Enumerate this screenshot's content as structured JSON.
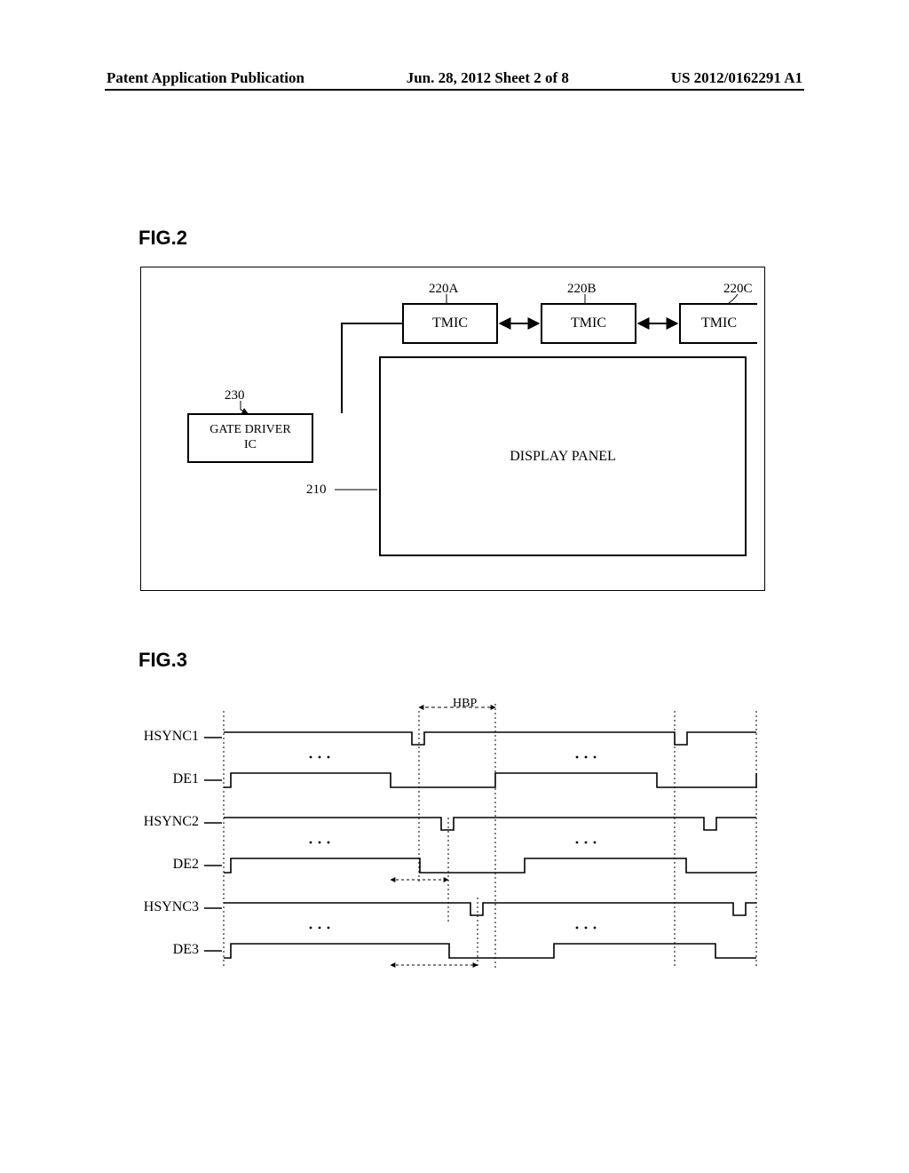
{
  "header": {
    "left": "Patent Application Publication",
    "mid": "Jun. 28, 2012  Sheet 2 of 8",
    "right": "US 2012/0162291 A1"
  },
  "figlabels": {
    "f2": "FIG.2",
    "f3": "FIG.3"
  },
  "fig2": {
    "tmic": "TMIC",
    "dispanel": "DISPLAY PANEL",
    "gatedrv": "GATE DRIVER\nIC",
    "ref220A": "220A",
    "ref220B": "220B",
    "ref220C": "220C",
    "ref230": "230",
    "ref210": "210"
  },
  "fig3": {
    "hbp": "HBP",
    "signals": [
      "HSYNC1",
      "DE1",
      "HSYNC2",
      "DE2",
      "HSYNC3",
      "DE3"
    ]
  },
  "chart_data": {
    "type": "table",
    "description": "Timing diagram: three sets of HSYNC (negative pulse) and DE (active-high) signals; HSYNC2/DE2 and HSYNC3/DE3 are progressively shifted right relative to HSYNC1/DE1. HBP (horizontal back porch) spans from HSYNC falling edge to DE rising edge.",
    "signals": [
      {
        "name": "HSYNC1",
        "type": "negative-pulse",
        "period_rel": 1.0,
        "offset_rel": 0.0,
        "pulse_width_rel": 0.03
      },
      {
        "name": "DE1",
        "type": "active-high-with-blank",
        "period_rel": 1.0,
        "offset_rel": 0.0,
        "blank_start_rel": 0.41,
        "blank_end_rel": 0.57
      },
      {
        "name": "HSYNC2",
        "type": "negative-pulse",
        "period_rel": 1.0,
        "offset_rel": 0.09,
        "pulse_width_rel": 0.03
      },
      {
        "name": "DE2",
        "type": "active-high-with-blank",
        "period_rel": 1.0,
        "offset_rel": 0.09,
        "blank_start_rel": 0.41,
        "blank_end_rel": 0.57
      },
      {
        "name": "HSYNC3",
        "type": "negative-pulse",
        "period_rel": 1.0,
        "offset_rel": 0.18,
        "pulse_width_rel": 0.03
      },
      {
        "name": "DE3",
        "type": "active-high-with-blank",
        "period_rel": 1.0,
        "offset_rel": 0.18,
        "blank_start_rel": 0.41,
        "blank_end_rel": 0.57
      }
    ],
    "hbp_span_rel": {
      "start": 0.44,
      "end": 0.57
    }
  }
}
